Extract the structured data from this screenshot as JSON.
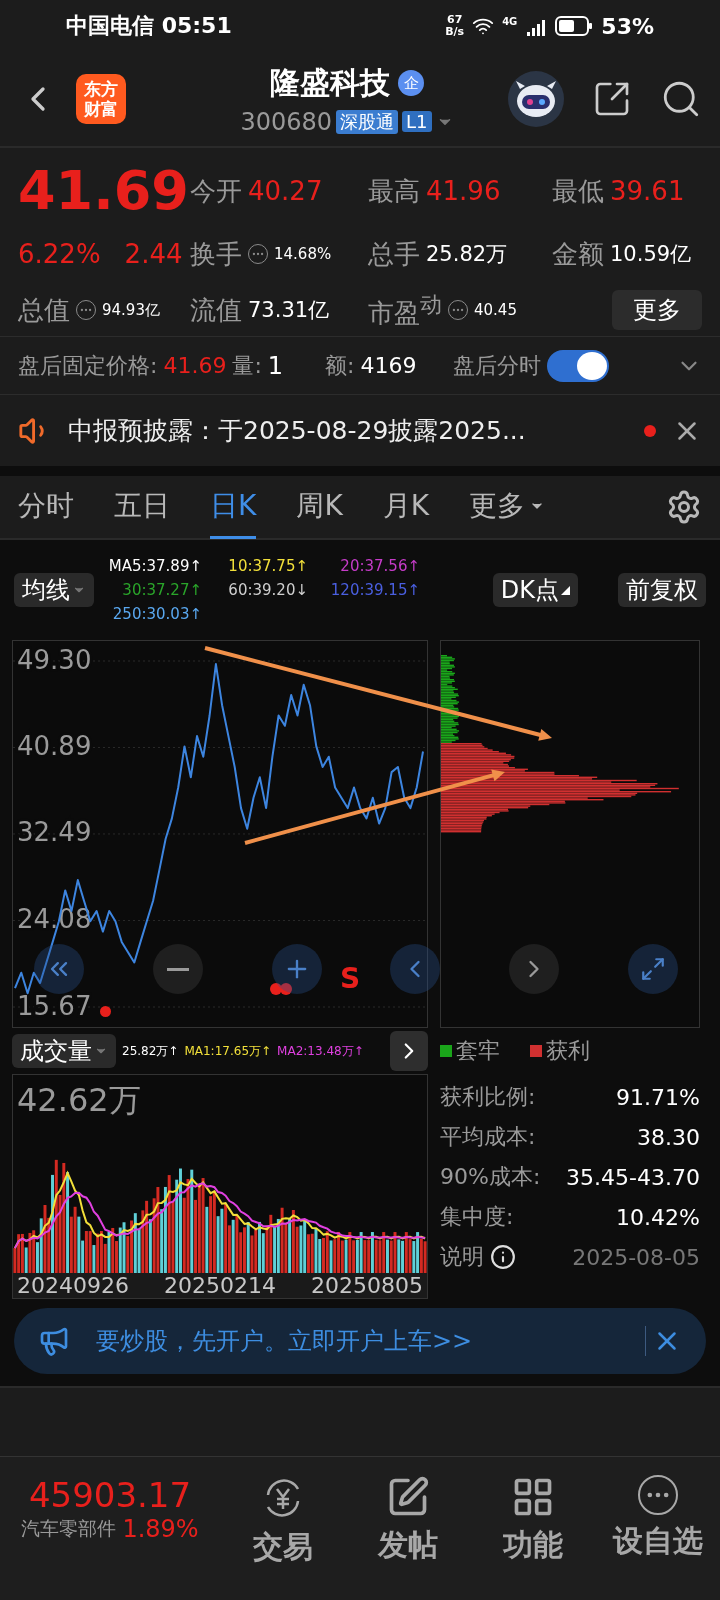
{
  "status_bar": {
    "carrier_time": "中国电信 05:51",
    "net_speed": [
      "67",
      "B/s"
    ],
    "network": "4G",
    "battery": "53%"
  },
  "header": {
    "logo": [
      "东方",
      "财富"
    ],
    "title": "隆盛科技",
    "title_badge": "企",
    "code": "300680",
    "badges": [
      "深股通",
      "L1"
    ]
  },
  "quote": {
    "price": "41.69",
    "change_pct": "6.22%",
    "change": "2.44",
    "stats": [
      {
        "label": "今开",
        "value": "40.27",
        "kind": "price"
      },
      {
        "label": "最高",
        "value": "41.96",
        "kind": "price"
      },
      {
        "label": "最低",
        "value": "39.61",
        "kind": "price"
      },
      {
        "label": "换手",
        "value": "14.68%",
        "kind": "info"
      },
      {
        "label": "总手",
        "value": "25.82万",
        "kind": "plain"
      },
      {
        "label": "金额",
        "value": "10.59亿",
        "kind": "plain"
      },
      {
        "label": "总值",
        "value": "94.93亿",
        "kind": "info"
      },
      {
        "label": "流值",
        "value": "73.31亿",
        "kind": "plain"
      },
      {
        "label": "市盈$^{动}$",
        "value": "40.45",
        "kind": "info"
      }
    ],
    "more_button": "更多"
  },
  "after_hours": {
    "label": "盘后固定价格:",
    "price": "41.69",
    "volume_label": "量:",
    "volume": "1",
    "amount_label": "额:",
    "amount": "4169",
    "chart_toggle": {
      "label": "盘后分时",
      "on": true
    }
  },
  "notice": {
    "text": "中报预披露：于2025-08-29披露2025...",
    "unread": true
  },
  "chart_tabs": [
    {
      "label": "分时",
      "selected": false,
      "kind": "tab"
    },
    {
      "label": "五日",
      "selected": false,
      "kind": "tab"
    },
    {
      "label": "日K",
      "selected": true,
      "kind": "tab"
    },
    {
      "label": "周K",
      "selected": false,
      "kind": "tab"
    },
    {
      "label": "月K",
      "selected": false,
      "kind": "tab"
    },
    {
      "label": "更多",
      "selected": false,
      "kind": "menu"
    }
  ],
  "indicator_bar": {
    "ma_menu": "均线",
    "ma_values": [
      {
        "text": "MA5:37.89↑",
        "color": "#ffffff"
      },
      {
        "text": "10:37.75↑",
        "color": "#f2e03a"
      },
      {
        "text": "20:37.56↑",
        "color": "#c53cc8"
      },
      {
        "text": "30:37.27↑",
        "color": "#2aa52a"
      },
      {
        "text": "60:39.20↓",
        "color": "#cfcfcf"
      },
      {
        "text": "120:39.15↑",
        "color": "#4a5fe0"
      },
      {
        "text": "250:30.03↑",
        "color": "#5aa8f0"
      }
    ],
    "dk_button": "DK点",
    "adjust_button": "前复权"
  },
  "price_chart": {
    "signal": "S",
    "chart_data": {
      "type": "line",
      "grid": true,
      "ylim": [
        15.67,
        49.3
      ],
      "yticks": [
        {
          "value": 49.3,
          "label": "49.30"
        },
        {
          "value": 40.89,
          "label": "40.89"
        },
        {
          "value": 32.49,
          "label": "32.49"
        },
        {
          "value": 24.08,
          "label": "24.08"
        },
        {
          "value": 15.67,
          "label": "15.67"
        }
      ],
      "series": [
        {
          "color": "#3d85e0",
          "values": [
            17.5,
            19,
            17,
            19,
            18,
            20,
            22,
            24,
            27,
            25,
            28,
            26,
            24,
            25,
            23,
            25,
            24,
            22,
            21,
            20,
            22,
            24,
            26,
            29,
            32,
            34,
            37,
            41,
            38,
            42,
            40,
            44,
            49,
            45,
            42,
            39,
            35,
            33,
            36,
            38,
            35,
            40,
            44,
            43,
            46,
            44,
            47,
            45,
            41,
            39,
            40,
            37,
            36,
            35,
            37,
            35,
            34,
            36,
            33.5,
            35,
            38.5,
            39,
            36,
            35,
            37,
            40.5
          ]
        }
      ]
    }
  },
  "volume": {
    "menu": "成交量",
    "readings": [
      {
        "text": "25.82万↑",
        "color": "#ffffff"
      },
      {
        "text": "MA1:17.65万↑",
        "color": "#f2e03a"
      },
      {
        "text": "MA2:13.48万↑",
        "color": "#e040e0"
      }
    ],
    "max_label": "42.62万",
    "dates": [
      "20240926",
      "20250214",
      "20250805"
    ]
  },
  "chips": {
    "legend": [
      {
        "label": "套牢",
        "color": "#1aa51a"
      },
      {
        "label": "获利",
        "color": "#d03030"
      }
    ],
    "stats": [
      {
        "label": "获利比例:",
        "value": "91.71%"
      },
      {
        "label": "平均成本:",
        "value": "38.30"
      },
      {
        "label": "90%成本:",
        "value": "35.45-43.70"
      },
      {
        "label": "集中度:",
        "value": "10.42%"
      }
    ],
    "note": "说明",
    "date": "2025-08-05"
  },
  "banner": {
    "text": "要炒股，先开户。立即开户上车>>"
  },
  "bottom_bar": {
    "index_value": "45903.17",
    "sector": "汽车零部件",
    "sector_change": "1.89%",
    "actions": [
      {
        "label": "交易",
        "kind": "trade"
      },
      {
        "label": "发帖",
        "kind": "post"
      },
      {
        "label": "功能",
        "kind": "apps"
      },
      {
        "label": "设自选",
        "kind": "watch"
      }
    ]
  }
}
